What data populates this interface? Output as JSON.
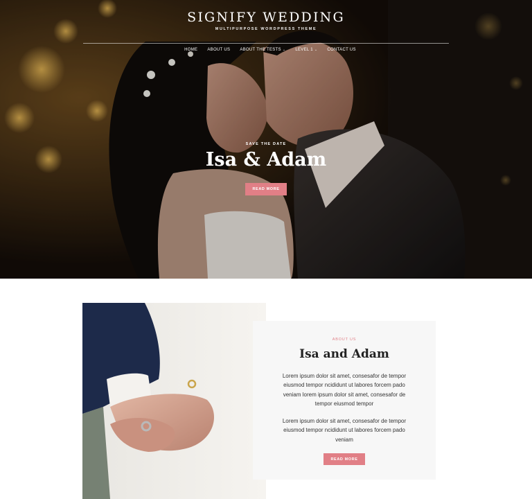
{
  "header": {
    "site_title": "SIGNIFY WEDDING",
    "tagline": "MULTIPURPOSE WORDPRESS THEME"
  },
  "nav": {
    "items": [
      {
        "label": "HOME",
        "has_dropdown": false
      },
      {
        "label": "ABOUT US",
        "has_dropdown": false
      },
      {
        "label": "ABOUT THE TESTS",
        "has_dropdown": true
      },
      {
        "label": "LEVEL 1",
        "has_dropdown": true
      },
      {
        "label": "CONTACT US",
        "has_dropdown": false
      }
    ],
    "dropdown_glyph": "⌄"
  },
  "hero": {
    "eyebrow": "SAVE THE DATE",
    "heading": "Isa & Adam",
    "button_label": "READ MORE"
  },
  "about": {
    "eyebrow": "ABOUT US",
    "title": "Isa and Adam",
    "paragraph_1": "Lorem ipsum dolor sit amet, consesafor de tempor eiusmod tempor ncididunt ut labores forcem pado veniam lorem ipsum dolor sit amet, consesafor de tempor eiusmod tempor",
    "paragraph_2": "Lorem ipsum dolor sit amet, consesafor de tempor eiusmod tempor ncididunt ut labores forcem pado veniam",
    "button_label": "READ MORE"
  },
  "colors": {
    "accent": "#e17f86",
    "card_bg": "#f7f7f7",
    "hero_dark": "#1a120c"
  }
}
